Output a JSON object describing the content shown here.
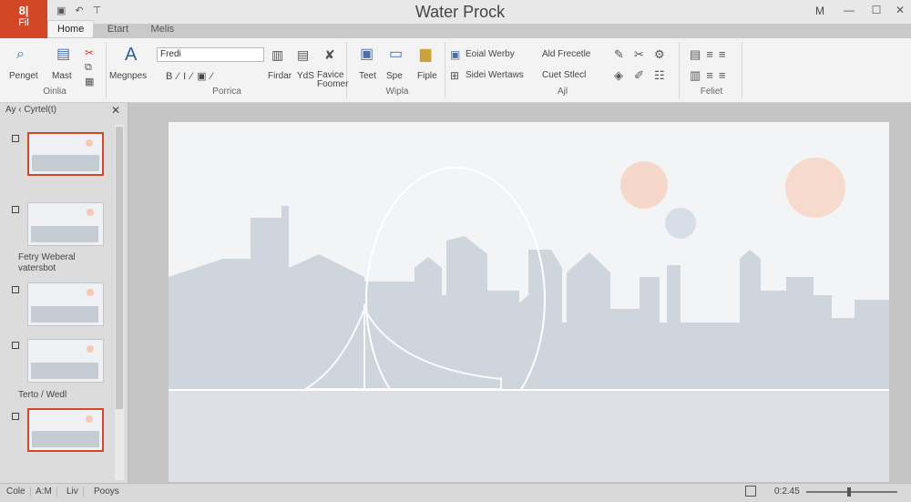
{
  "window": {
    "title": "Water Prock",
    "user_initial": "M",
    "file_tab": {
      "glyph": "8|",
      "label": "Fil"
    },
    "tabs": [
      "Home",
      "Etart",
      "Melis"
    ],
    "controls": {
      "minimize": "—",
      "restore": "☐",
      "close": "✕"
    }
  },
  "ribbon": {
    "groups": {
      "clipboard": {
        "label": "Oinlia",
        "buttons": [
          "Penget",
          "Mast"
        ]
      },
      "font": {
        "label": "Porrica",
        "font_value": "Fredi",
        "ligatures_label": "Megnpes",
        "extra_buttons": [
          "Firdar",
          "YdS",
          "Favice Foomer"
        ]
      },
      "slides": {
        "label": "Wipla",
        "buttons": [
          "Teet",
          "Spe",
          "Fiple"
        ]
      },
      "drawing": {
        "label": "Ajl",
        "buttons": [
          "Eoial Werby",
          "Sidei Wertaws",
          "Ald Frecetle",
          "Cuet Stlecl"
        ]
      },
      "editing": {
        "label": "Feliet"
      }
    }
  },
  "pane": {
    "header": "Ay ‹ Cyrtel(t)",
    "sections": [
      "Fetry Weberal\nvatersbot",
      "Terto / Wedl"
    ],
    "selected_slides": [
      1,
      5
    ]
  },
  "statusbar": {
    "items": [
      "Cole",
      "A:M",
      "Liv",
      "Pooys"
    ],
    "zoom": "0:2.45"
  },
  "colors": {
    "accent": "#d24726",
    "skyline": "#cdd3da",
    "sun": "#f5cfbd",
    "moon": "#d9dfe7"
  }
}
